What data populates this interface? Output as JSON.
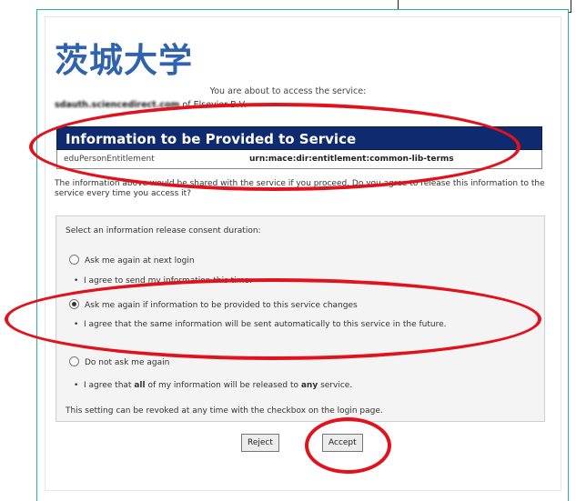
{
  "logo": "茨城大学",
  "about_text": "You are about to access the service:",
  "service": {
    "name": "sdauth.sciencedirect.com",
    "owner": "of Elsevier B.V."
  },
  "info_section": {
    "title": "Information to be Provided to Service",
    "attribute": {
      "name": "eduPersonEntitlement",
      "value": "urn:mace:dir:entitlement:common-lib-terms"
    }
  },
  "notice": "The information above would be shared with the service if you proceed. Do you agree to release this information to the service every time you access it?",
  "consent": {
    "title": "Select an information release consent duration:",
    "options": [
      {
        "label": "Ask me again at next login",
        "selected": false,
        "description": "I agree to send my information this time."
      },
      {
        "label": "Ask me again if information to be provided to this service changes",
        "selected": true,
        "description": "I agree that the same information will be sent automatically to this service in the future."
      },
      {
        "label": "Do not ask me again",
        "selected": false,
        "description_pre": "I agree that ",
        "description_bold1": "all",
        "description_mid": " of my information will be released to ",
        "description_bold2": "any",
        "description_post": " service."
      }
    ],
    "footnote": "This setting can be revoked at any time with the checkbox on the login page."
  },
  "buttons": {
    "reject": "Reject",
    "accept": "Accept"
  },
  "colors": {
    "logo": "#2f63ad",
    "header_bg": "#0f2a6e",
    "annotation": "#e1121c",
    "frame": "#29b3a1"
  }
}
